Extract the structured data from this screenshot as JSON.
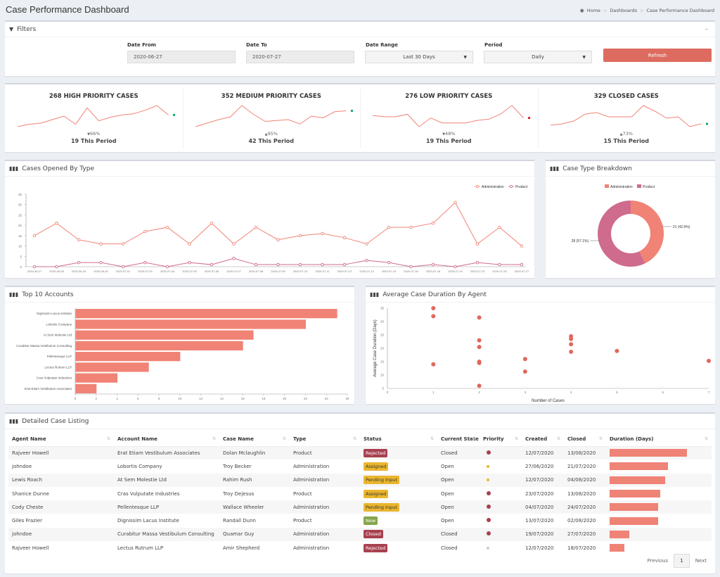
{
  "page": {
    "title": "Case Performance Dashboard"
  },
  "breadcrumb": [
    {
      "label": "Home",
      "icon": "dashboard-icon"
    },
    {
      "label": "Dashboards"
    },
    {
      "label": "Case Performance Dashboard"
    }
  ],
  "filters": {
    "title": "Filters",
    "collapse_icon": "minus-icon",
    "date_from_label": "Date From",
    "date_from_value": "2020-06-27",
    "date_to_label": "Date To",
    "date_to_value": "2020-07-27",
    "date_range_label": "Date Range",
    "date_range_value": "Last 30 Days",
    "period_label": "Period",
    "period_value": "Daily",
    "refresh_label": "Refresh"
  },
  "kpis": [
    {
      "title": "268 HIGH PRIORITY CASES",
      "trend": "down",
      "pct": "66%",
      "period": "19 This Period",
      "dot_color": "#00a65a",
      "spark": [
        3,
        5,
        6,
        9,
        12,
        5,
        19,
        8,
        11,
        13,
        14,
        17,
        21,
        13
      ]
    },
    {
      "title": "352 MEDIUM PRIORITY CASES",
      "trend": "up",
      "pct": "95%",
      "period": "42 This Period",
      "dot_color": "#00a65a",
      "spark": [
        2,
        6,
        10,
        13,
        26,
        16,
        8,
        9,
        10,
        5,
        14,
        12,
        19,
        20
      ]
    },
    {
      "title": "276 LOW PRIORITY CASES",
      "trend": "down",
      "pct": "48%",
      "period": "19 This Period",
      "dot_color": "#dd1111",
      "spark": [
        13,
        12,
        12,
        14,
        4,
        11,
        7,
        7,
        7,
        9,
        10,
        14,
        21,
        11
      ]
    },
    {
      "title": "329 CLOSED CASES",
      "trend": "up",
      "pct": "73%",
      "period": "15 This Period",
      "dot_color": "#00a65a",
      "spark": [
        8,
        9,
        11,
        16,
        17,
        14,
        14,
        14,
        22,
        18,
        13,
        14,
        7,
        9
      ]
    }
  ],
  "colors": {
    "admin": "#f08375",
    "product": "#cf6b8d",
    "accent": "#dd6b5f"
  },
  "chart_data": [
    {
      "type": "line",
      "title": "Cases Opened By Type",
      "x": [
        "2020-06-27",
        "2020-06-28",
        "2020-06-29",
        "2020-06-30",
        "2020-07-01",
        "2020-07-03",
        "2020-07-04",
        "2020-07-05",
        "2020-07-06",
        "2020-07-07",
        "2020-07-08",
        "2020-07-09",
        "2020-07-10",
        "2020-07-11",
        "2020-07-12",
        "2020-07-13",
        "2020-07-15",
        "2020-07-16",
        "2020-07-18",
        "2020-07-19",
        "2020-07-23",
        "2020-07-25",
        "2020-07-27"
      ],
      "series": [
        {
          "name": "Administration",
          "values": [
            15,
            21,
            13,
            11,
            11,
            17,
            19,
            11,
            21,
            11,
            19,
            13,
            15,
            16,
            14,
            11,
            19,
            19,
            21,
            31,
            11,
            19,
            10
          ]
        },
        {
          "name": "Product",
          "values": [
            0,
            0,
            2,
            2,
            0,
            2,
            0,
            2,
            1,
            4,
            1,
            1,
            1,
            1,
            1,
            3,
            2,
            0,
            1,
            0,
            2,
            1,
            1
          ]
        }
      ],
      "ylim": [
        0,
        35
      ],
      "yticks": [
        0,
        5,
        10,
        15,
        20,
        25,
        30,
        35
      ],
      "legend": "top-right"
    },
    {
      "type": "pie",
      "title": "Case Type Breakdown",
      "categories": [
        "Administration",
        "Product"
      ],
      "values": [
        21,
        28
      ],
      "labels": [
        "21 (42.9%)",
        "28 (57.1%)"
      ],
      "donut": true,
      "legend": "top"
    },
    {
      "type": "bar",
      "orientation": "horizontal",
      "title": "Top 10 Accounts",
      "categories": [
        "Dignissim Lacus Institute",
        "Lobortis Company",
        "At Sem Molestie Ltd",
        "Curabitur Massa Vestibulum Consulting",
        "Pellentesque LLP",
        "Lectus Rutrum LLP",
        "Cras Vulputate Industries",
        "Erat Etiam Vestibulum Associates"
      ],
      "values": [
        25,
        22,
        17,
        16,
        10,
        7,
        4,
        2
      ],
      "xlim": [
        0,
        26
      ],
      "xticks": [
        0,
        2,
        4,
        6,
        8,
        10,
        12,
        14,
        16,
        18,
        20,
        22,
        24,
        26
      ]
    },
    {
      "type": "scatter",
      "title": "Average Case Duration By Agent",
      "xlabel": "Number of Cases",
      "ylabel": "Average Case Duration (Days)",
      "points": [
        [
          1,
          35
        ],
        [
          1,
          32
        ],
        [
          1,
          14
        ],
        [
          2,
          31.5
        ],
        [
          2,
          23
        ],
        [
          2,
          20.5
        ],
        [
          2,
          15
        ],
        [
          2,
          14.5
        ],
        [
          2,
          6
        ],
        [
          3,
          16
        ],
        [
          3,
          11.3
        ],
        [
          4,
          24.5
        ],
        [
          4,
          23.5
        ],
        [
          4,
          21.5
        ],
        [
          4,
          18.7
        ],
        [
          5,
          19
        ],
        [
          7,
          15.3
        ]
      ],
      "xlim": [
        0,
        7
      ],
      "ylim": [
        5,
        35
      ],
      "xticks": [
        0,
        1,
        2,
        3,
        4,
        5,
        6,
        7
      ],
      "yticks": [
        5,
        10,
        15,
        20,
        25,
        30,
        35
      ]
    }
  ],
  "table": {
    "title": "Detailed Case Listing",
    "columns": [
      "Agent Name",
      "Account Name",
      "Case Name",
      "Type",
      "Status",
      "Current State",
      "Priority",
      "Created",
      "Closed",
      "Duration (Days)"
    ],
    "rows": [
      {
        "agent": "Rajveer Howell",
        "account": "Erat Etiam Vestibulum Associates",
        "case": "Dolan Mclaughlin",
        "type": "Product",
        "status": "Rejected",
        "state": "Closed",
        "priority": "high",
        "created": "12/07/2020",
        "closed": "13/08/2020",
        "duration": 32
      },
      {
        "agent": "johndoe",
        "account": "Lobortis Company",
        "case": "Troy Becker",
        "type": "Administration",
        "status": "Assigned",
        "state": "Open",
        "priority": "medium",
        "created": "27/06/2020",
        "closed": "21/07/2020",
        "duration": 24
      },
      {
        "agent": "Lewis Roach",
        "account": "At Sem Molestie Ltd",
        "case": "Rahim Rush",
        "type": "Administration",
        "status": "Pending Input",
        "state": "Open",
        "priority": "medium",
        "created": "12/07/2020",
        "closed": "04/08/2020",
        "duration": 23
      },
      {
        "agent": "Shanice Dunne",
        "account": "Cras Vulputate Industries",
        "case": "Troy Dejesus",
        "type": "Product",
        "status": "Assigned",
        "state": "Open",
        "priority": "high",
        "created": "23/07/2020",
        "closed": "13/08/2020",
        "duration": 21
      },
      {
        "agent": "Cody Cheste",
        "account": "Pellentesque LLP",
        "case": "Wallace Wheeler",
        "type": "Administration",
        "status": "Pending Input",
        "state": "Open",
        "priority": "high",
        "created": "04/07/2020",
        "closed": "24/07/2020",
        "duration": 20
      },
      {
        "agent": "Giles Frazier",
        "account": "Dignissim Lacus Institute",
        "case": "Randall Dunn",
        "type": "Product",
        "status": "New",
        "state": "Open",
        "priority": "high",
        "created": "13/07/2020",
        "closed": "02/08/2020",
        "duration": 20
      },
      {
        "agent": "johndoe",
        "account": "Curabitur Massa Vestibulum Consulting",
        "case": "Quamar Guy",
        "type": "Administration",
        "status": "Closed",
        "state": "Closed",
        "priority": "high",
        "created": "19/07/2020",
        "closed": "27/07/2020",
        "duration": 8
      },
      {
        "agent": "Rajveer Howell",
        "account": "Lectus Rutrum LLP",
        "case": "Amir Shepherd",
        "type": "Administration",
        "status": "Rejected",
        "state": "Closed",
        "priority": "low",
        "created": "12/07/2020",
        "closed": "18/07/2020",
        "duration": 6
      }
    ],
    "status_colors": {
      "Rejected": "#a8404f",
      "Assigned": "#eab62d",
      "Pending Input": "#eab62d",
      "New": "#86a64a",
      "Closed": "#a8404f"
    },
    "priority_colors": {
      "high": "#a8404f",
      "medium": "#eab62d",
      "low": "#cccccc"
    },
    "pagination": {
      "previous": "Previous",
      "current": "1",
      "next": "Next"
    }
  }
}
